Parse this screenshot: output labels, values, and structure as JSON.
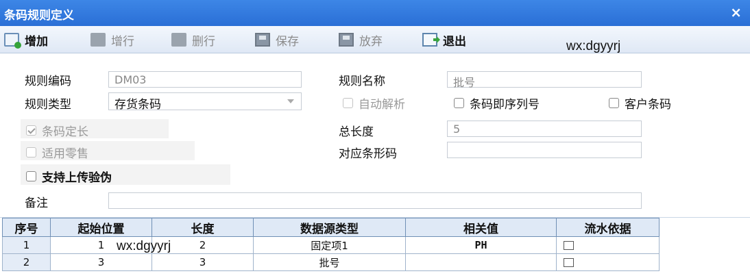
{
  "window": {
    "title": "条码规则定义",
    "close_icon": "×"
  },
  "toolbar": {
    "add": "增加",
    "add_row": "增行",
    "delete_row": "删行",
    "save": "保存",
    "discard": "放弃",
    "exit": "退出"
  },
  "watermarks": [
    "wx:dgyyrj",
    "wx:dgyyrj"
  ],
  "form": {
    "rule_code_label": "规则编码",
    "rule_code_value": "DM03",
    "rule_name_label": "规则名称",
    "rule_name_value": "批号",
    "rule_type_label": "规则类型",
    "rule_type_value": "存货条码",
    "auto_parse_label": "自动解析",
    "barcode_is_serial_label": "条码即序列号",
    "customer_barcode_label": "客户条码",
    "fixed_length_label": "条码定长",
    "retail_label": "适用零售",
    "upload_verify_label": "支持上传验伪",
    "total_length_label": "总长度",
    "total_length_value": "5",
    "barcode_label": "对应条形码",
    "barcode_value": "",
    "remark_label": "备注",
    "remark_value": ""
  },
  "table": {
    "headers": [
      "序号",
      "起始位置",
      "长度",
      "数据源类型",
      "相关值",
      "流水依据"
    ],
    "rows": [
      {
        "seq": "1",
        "start": "1",
        "length": "2",
        "source": "固定项1",
        "value": "PH"
      },
      {
        "seq": "2",
        "start": "3",
        "length": "3",
        "source": "批号",
        "value": ""
      }
    ]
  }
}
